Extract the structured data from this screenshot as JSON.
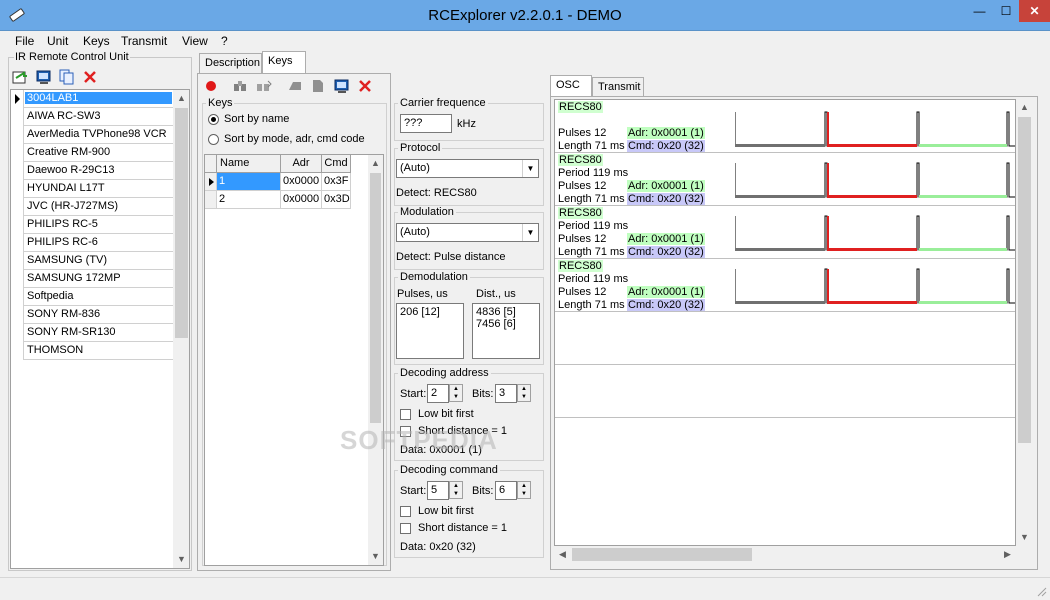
{
  "window": {
    "title": "RCExplorer v2.2.0.1 - DEMO",
    "minimize": "—",
    "maximize": "☐",
    "close": "✕"
  },
  "menu": [
    "File",
    "Unit",
    "Keys",
    "Transmit",
    "View",
    "?"
  ],
  "left_panel": {
    "label": "IR Remote Control Unit",
    "units": [
      "3004LAB1",
      "AIWA RC-SW3",
      "AverMedia TVPhone98 VCR",
      "Creative RM-900",
      "Daewoo R-29C13",
      "HYUNDAI L17T",
      "JVC (HR-J727MS)",
      "PHILIPS RC-5",
      "PHILIPS RC-6",
      "SAMSUNG (TV)",
      "SAMSUNG 172MP",
      "Softpedia",
      "SONY RM-836",
      "SONY RM-SR130",
      "THOMSON"
    ],
    "selected_index": 0
  },
  "tabs": {
    "description": "Description",
    "keys": "Keys"
  },
  "keys_group": {
    "label": "Keys",
    "sort_by_name": "Sort by name",
    "sort_by_mode": "Sort by mode, adr, cmd code",
    "columns": [
      "Name",
      "Adr",
      "Cmd"
    ],
    "rows": [
      [
        "1",
        "0x0000",
        "0x3F"
      ],
      [
        "2",
        "0x0000",
        "0x3D"
      ]
    ]
  },
  "carrier": {
    "label": "Carrier frequence",
    "value": "???",
    "unit": "kHz"
  },
  "protocol": {
    "label": "Protocol",
    "value": "(Auto)",
    "detect": "Detect: RECS80"
  },
  "modulation": {
    "label": "Modulation",
    "value": "(Auto)",
    "detect": "Detect: Pulse distance"
  },
  "demodulation": {
    "label": "Demodulation",
    "pulses_label": "Pulses, us",
    "dist_label": "Dist., us",
    "pulses": [
      "206 [12]"
    ],
    "dist": [
      "4836 [5]",
      "7456 [6]"
    ]
  },
  "decoding_address": {
    "label": "Decoding address",
    "start_label": "Start:",
    "start": "2",
    "bits_label": "Bits:",
    "bits": "3",
    "low_bit_first": "Low bit first",
    "short_distance": "Short distance = 1",
    "data": "Data: 0x0001 (1)"
  },
  "decoding_command": {
    "label": "Decoding command",
    "start_label": "Start:",
    "start": "5",
    "bits_label": "Bits:",
    "bits": "6",
    "low_bit_first": "Low bit first",
    "short_distance": "Short distance = 1",
    "data": "Data: 0x20 (32)"
  },
  "osc_tabs": {
    "osc": "OSC",
    "transmit": "Transmit"
  },
  "signals": [
    {
      "name": "RECS80",
      "period": "",
      "pulses": "Pulses 12",
      "length": "Length 71 ms",
      "adr": "Adr: 0x0001 (1)",
      "cmd": "Cmd: 0x20 (32)"
    },
    {
      "name": "RECS80",
      "period": "Period 119 ms",
      "pulses": "Pulses 12",
      "length": "Length 71 ms",
      "adr": "Adr: 0x0001 (1)",
      "cmd": "Cmd: 0x20 (32)"
    },
    {
      "name": "RECS80",
      "period": "Period 119 ms",
      "pulses": "Pulses 12",
      "length": "Length 71 ms",
      "adr": "Adr: 0x0001 (1)",
      "cmd": "Cmd: 0x20 (32)"
    },
    {
      "name": "RECS80",
      "period": "Period 119 ms",
      "pulses": "Pulses 12",
      "length": "Length 71 ms",
      "adr": "Adr: 0x0001 (1)",
      "cmd": "Cmd: 0x20 (32)"
    }
  ],
  "watermark": "SOFTPEDIA",
  "colors": {
    "title_bar": "#6aa8e6",
    "selection": "#3399ff",
    "adr_highlight": "#c0ffc0",
    "cmd_highlight": "#c8c8f8",
    "close": "#c7433a"
  }
}
